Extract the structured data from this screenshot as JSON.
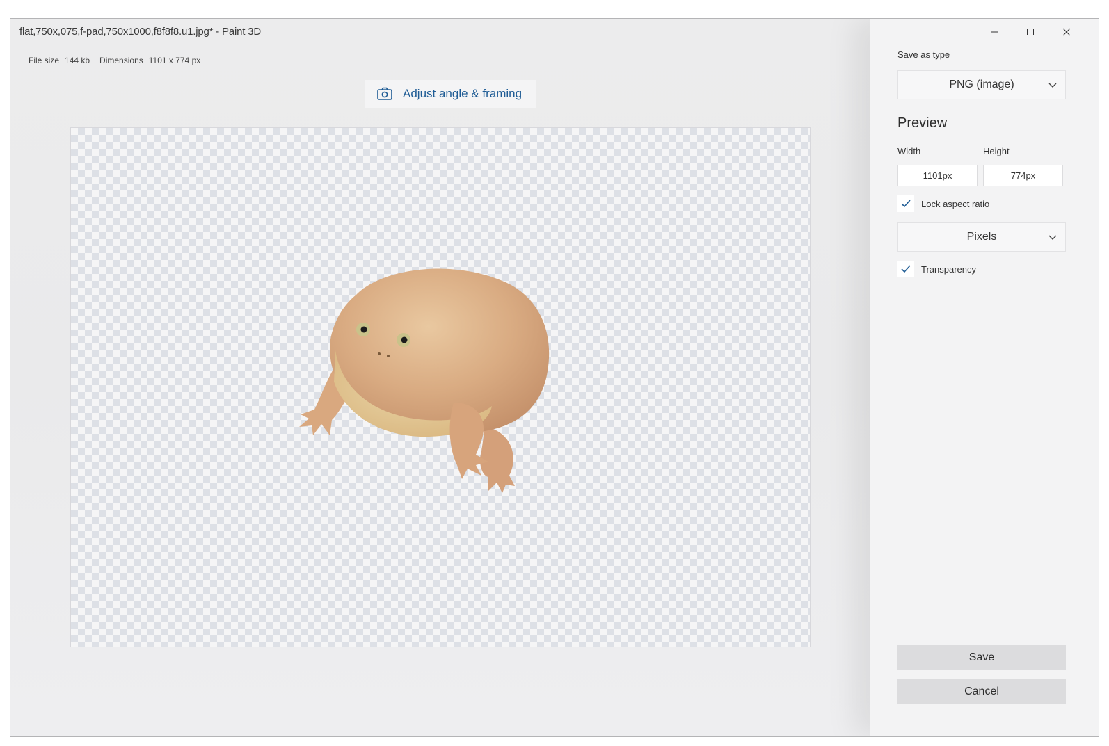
{
  "window": {
    "title": "flat,750x,075,f-pad,750x1000,f8f8f8.u1.jpg* - Paint 3D",
    "minimize_icon": "minimize-icon",
    "maximize_icon": "maximize-icon",
    "close_icon": "close-icon"
  },
  "file_info": {
    "size_label": "File size",
    "size_value": "144 kb",
    "dimensions_label": "Dimensions",
    "dimensions_value": "1101 x 774 px"
  },
  "adjust_button": {
    "label": "Adjust angle & framing",
    "icon": "camera-icon"
  },
  "sidebar": {
    "save_type_label": "Save as type",
    "save_type_value": "PNG (image)",
    "preview_heading": "Preview",
    "width_label": "Width",
    "width_value": "1101px",
    "height_label": "Height",
    "height_value": "774px",
    "lock_aspect_label": "Lock aspect ratio",
    "lock_aspect_checked": true,
    "units_value": "Pixels",
    "transparency_label": "Transparency",
    "transparency_checked": true,
    "save_label": "Save",
    "cancel_label": "Cancel"
  },
  "colors": {
    "accent": "#1f5c95",
    "checker": "#dde0e6"
  }
}
